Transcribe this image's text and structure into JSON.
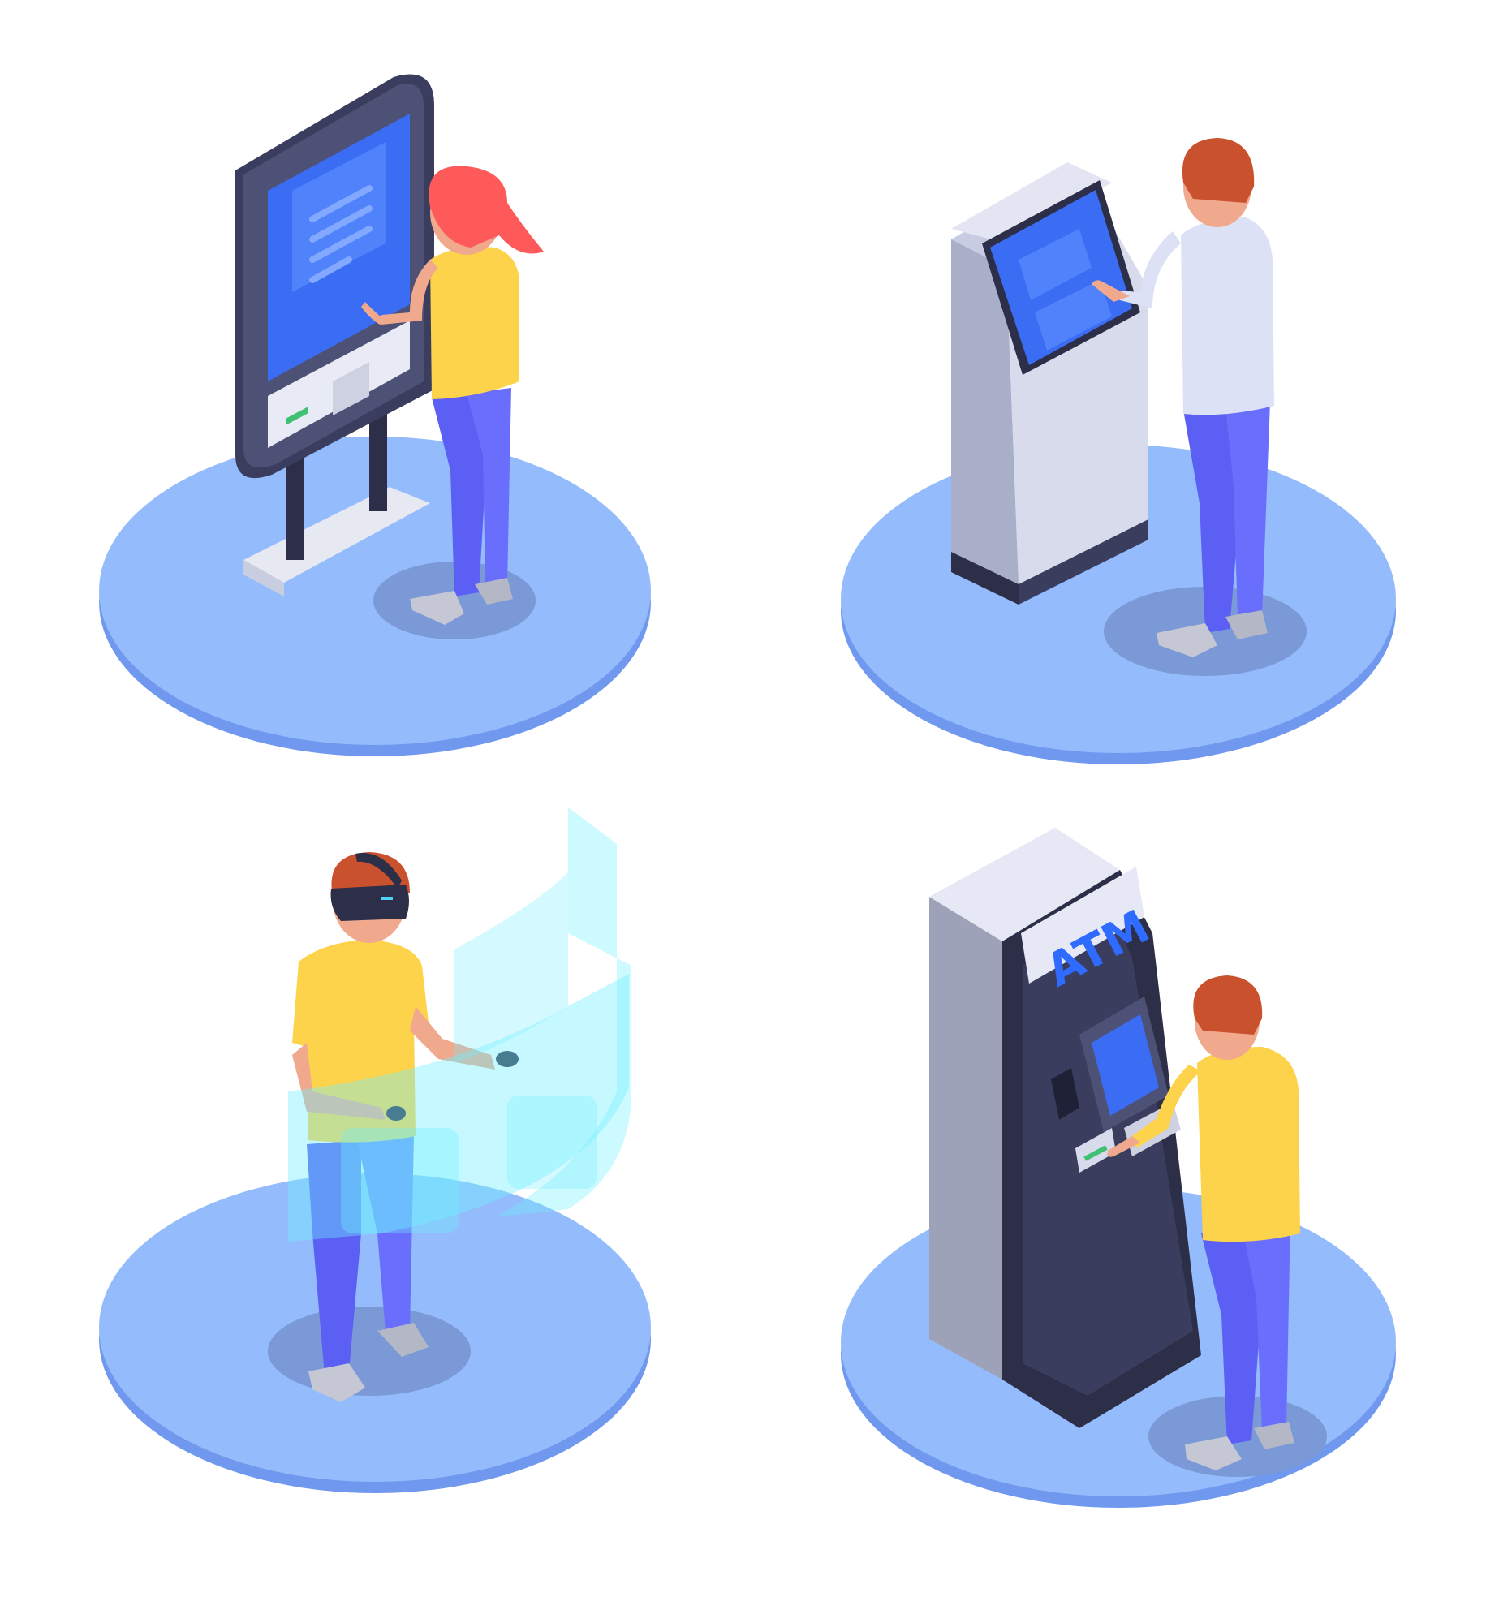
{
  "atm_sign": {
    "text": "ATM",
    "color": "#2f6bff"
  },
  "colors": {
    "platform": "#94bbfb",
    "platform_edge": "#6f98ee",
    "shadow": "#7a99d6",
    "screen_blue": "#3a6cf4",
    "shirt_yellow": "#fdd34b",
    "pants_blue": "#5b5ff4",
    "hair_red": "#ff5a5a",
    "hair_brown": "#c9512e",
    "skin": "#f0a98d",
    "hologram": "#6ff0ff"
  },
  "icons": [
    "self-service-kiosk",
    "ticket-terminal",
    "vr-headset-hologram",
    "atm-machine"
  ]
}
